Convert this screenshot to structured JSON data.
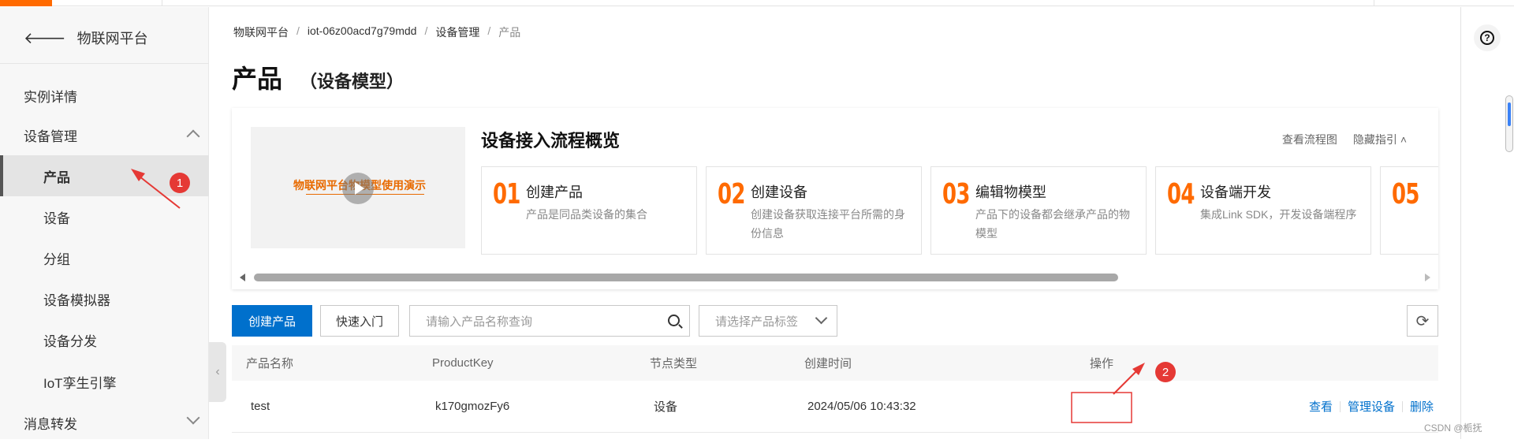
{
  "sidebar": {
    "back_label": "物联网平台",
    "items": [
      {
        "label": "实例详情"
      },
      {
        "label": "设备管理"
      },
      {
        "label": "产品"
      },
      {
        "label": "设备"
      },
      {
        "label": "分组"
      },
      {
        "label": "设备模拟器"
      },
      {
        "label": "设备分发"
      },
      {
        "label": "IoT孪生引擎"
      },
      {
        "label": "消息转发"
      }
    ]
  },
  "breadcrumb": [
    "物联网平台",
    "iot-06z00acd7g79mdd",
    "设备管理",
    "产品"
  ],
  "breadcrumb_sep": "/",
  "page": {
    "title": "产品",
    "subtitle": "（设备模型）"
  },
  "guide": {
    "video_text": "物联网平台物模型使用演示",
    "title": "设备接入流程概览",
    "link_flow": "查看流程图",
    "link_hide": "隐藏指引",
    "steps": [
      {
        "num": "01",
        "title": "创建产品",
        "desc": "产品是同品类设备的集合"
      },
      {
        "num": "02",
        "title": "创建设备",
        "desc": "创建设备获取连接平台所需的身份信息"
      },
      {
        "num": "03",
        "title": "编辑物模型",
        "desc": "产品下的设备都会继承产品的物模型"
      },
      {
        "num": "04",
        "title": "设备端开发",
        "desc": "集成Link SDK，开发设备端程序"
      },
      {
        "num": "05",
        "title": "",
        "desc": ""
      }
    ]
  },
  "toolbar": {
    "create_label": "创建产品",
    "quick_label": "快速入门",
    "search_placeholder": "请输入产品名称查询",
    "tag_placeholder": "请选择产品标签"
  },
  "table": {
    "headers": [
      "产品名称",
      "ProductKey",
      "节点类型",
      "创建时间",
      "操作"
    ],
    "rows": [
      {
        "name": "test",
        "key": "k170gmozFy6",
        "node": "设备",
        "created": "2024/05/06 10:43:32",
        "ops": [
          "查看",
          "管理设备",
          "删除"
        ]
      }
    ]
  },
  "annotations": [
    "1",
    "2"
  ],
  "watermark": "CSDN @栀抚",
  "colors": {
    "primary": "#0070cc",
    "accent": "#ff6a00",
    "annotation": "#e53935"
  }
}
